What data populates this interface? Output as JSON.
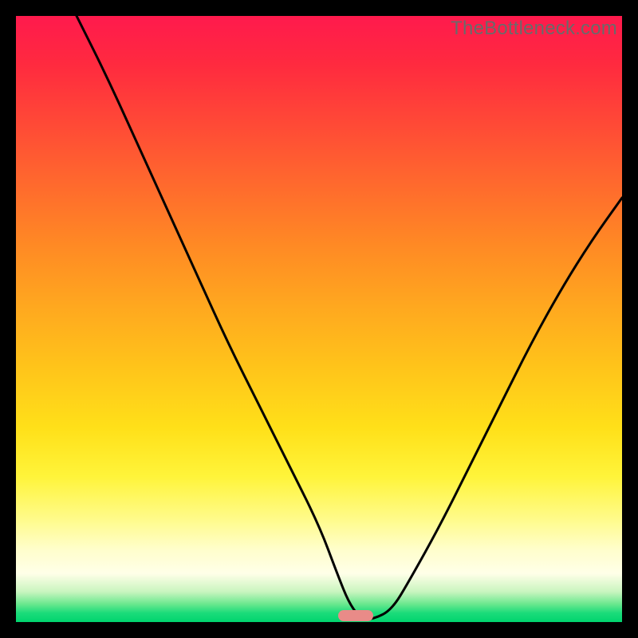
{
  "watermark": "TheBottleneck.com",
  "marker": {
    "x_pct": 56,
    "y_pct": 99.0,
    "color": "#e98b88"
  },
  "chart_data": {
    "type": "line",
    "title": "",
    "xlabel": "",
    "ylabel": "",
    "xlim": [
      0,
      100
    ],
    "ylim": [
      0,
      100
    ],
    "grid": false,
    "legend": false,
    "series": [
      {
        "name": "curve",
        "x": [
          10,
          15,
          20,
          25,
          30,
          35,
          40,
          45,
          50,
          53,
          55,
          57,
          59,
          62,
          65,
          70,
          75,
          80,
          85,
          90,
          95,
          100
        ],
        "y": [
          100,
          90,
          79,
          68,
          57,
          46,
          36,
          26,
          16,
          8,
          3,
          0.5,
          0.5,
          2,
          7,
          16,
          26,
          36,
          46,
          55,
          63,
          70
        ]
      }
    ],
    "annotations": [
      {
        "type": "marker",
        "shape": "pill",
        "x": 56,
        "y": 0.6,
        "color": "#e98b88"
      }
    ],
    "watermark": "TheBottleneck.com"
  }
}
